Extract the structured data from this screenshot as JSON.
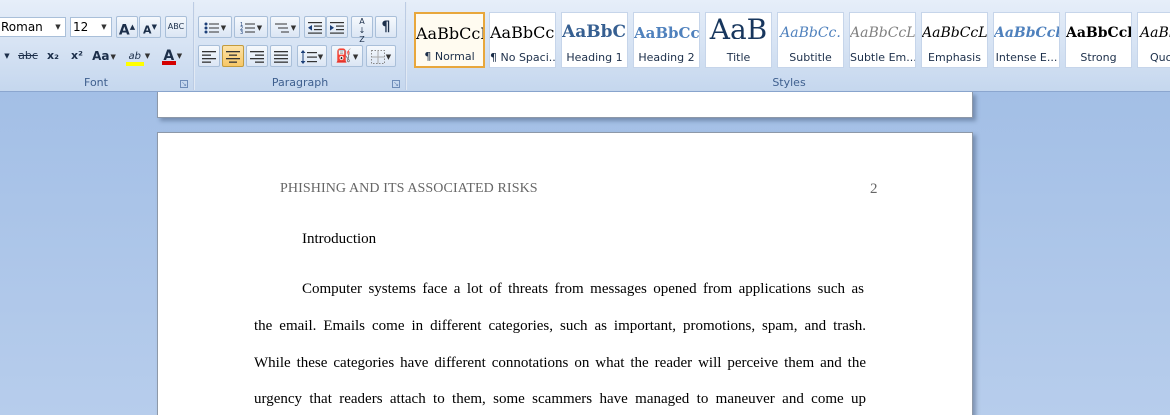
{
  "font_group": {
    "font_name": "Roman",
    "font_size": "12",
    "grow_font": "A",
    "shrink_font": "A",
    "clear_format": "ABC",
    "strikethrough": "abc",
    "subscript": "x₂",
    "superscript": "x²",
    "change_case": "Aa",
    "highlight": "ab",
    "font_color": "A",
    "label": "Font"
  },
  "paragraph_group": {
    "sort": "A↓Z",
    "show_marks": "¶",
    "label": "Paragraph"
  },
  "styles_group": {
    "label": "Styles",
    "tiles": [
      {
        "sample": "AaBbCcI",
        "name": "¶ Normal"
      },
      {
        "sample": "AaBbCcI",
        "name": "¶ No Spaci..."
      },
      {
        "sample": "AaBbC(",
        "name": "Heading 1"
      },
      {
        "sample": "AaBbCc",
        "name": "Heading 2"
      },
      {
        "sample": "AaB",
        "name": "Title"
      },
      {
        "sample": "AaBbCc.",
        "name": "Subtitle"
      },
      {
        "sample": "AaBbCcL",
        "name": "Subtle Em..."
      },
      {
        "sample": "AaBbCcL",
        "name": "Emphasis"
      },
      {
        "sample": "AaBbCcl",
        "name": "Intense E..."
      },
      {
        "sample": "AaBbCcl",
        "name": "Strong"
      },
      {
        "sample": "AaBl",
        "name": "Quo"
      }
    ]
  },
  "colors": {
    "highlight_bar": "#ffff00",
    "font_color_bar": "#d40000",
    "heading_blue": "#365f91",
    "subtitle_blue": "#4f81bd"
  },
  "document": {
    "running_head": "PHISHING AND ITS ASSOCIATED RISKS",
    "page_number": "2",
    "heading": "Introduction",
    "lines": [
      "Computer systems face a lot of threats from messages opened from applications such as",
      "the email. Emails come in different categories, such as important, promotions, spam, and trash.",
      "While these categories have different connotations on what the reader will perceive them and the",
      "urgency that readers attach to them, some scammers have managed to maneuver and come up"
    ]
  }
}
